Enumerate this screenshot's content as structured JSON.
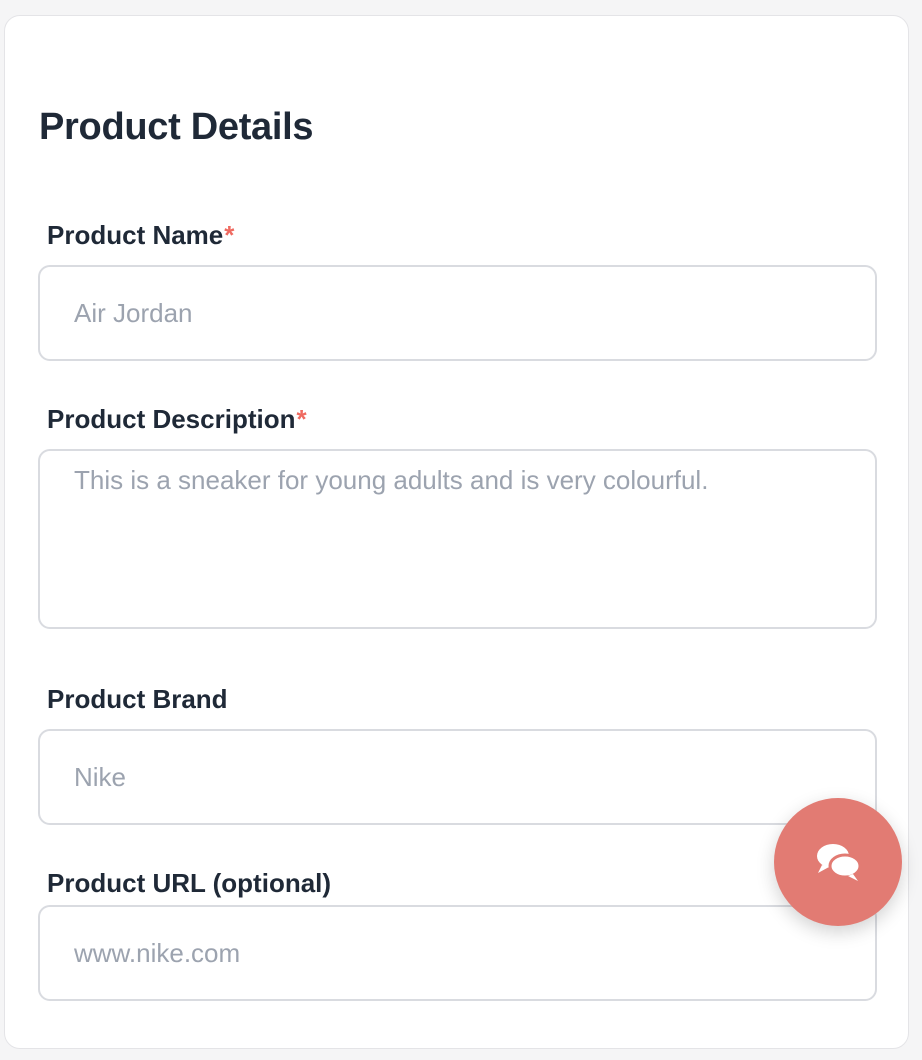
{
  "form": {
    "title": "Product Details",
    "required_marker": "*",
    "fields": {
      "name": {
        "label": "Product Name",
        "required": true,
        "placeholder": "Air Jordan"
      },
      "description": {
        "label": "Product Description",
        "required": true,
        "placeholder": "This is a sneaker for young adults and is very colourful."
      },
      "brand": {
        "label": "Product Brand",
        "required": false,
        "placeholder": "Nike"
      },
      "url": {
        "label": "Product URL (optional)",
        "required": false,
        "placeholder": "www.nike.com"
      }
    }
  },
  "chat_button": {
    "icon": "chat-bubbles-icon",
    "color": "#e27b73"
  },
  "colors": {
    "required_marker": "#ef6a60",
    "text": "#1f2937",
    "placeholder": "#9ca3af",
    "border": "#d9dbe0"
  }
}
